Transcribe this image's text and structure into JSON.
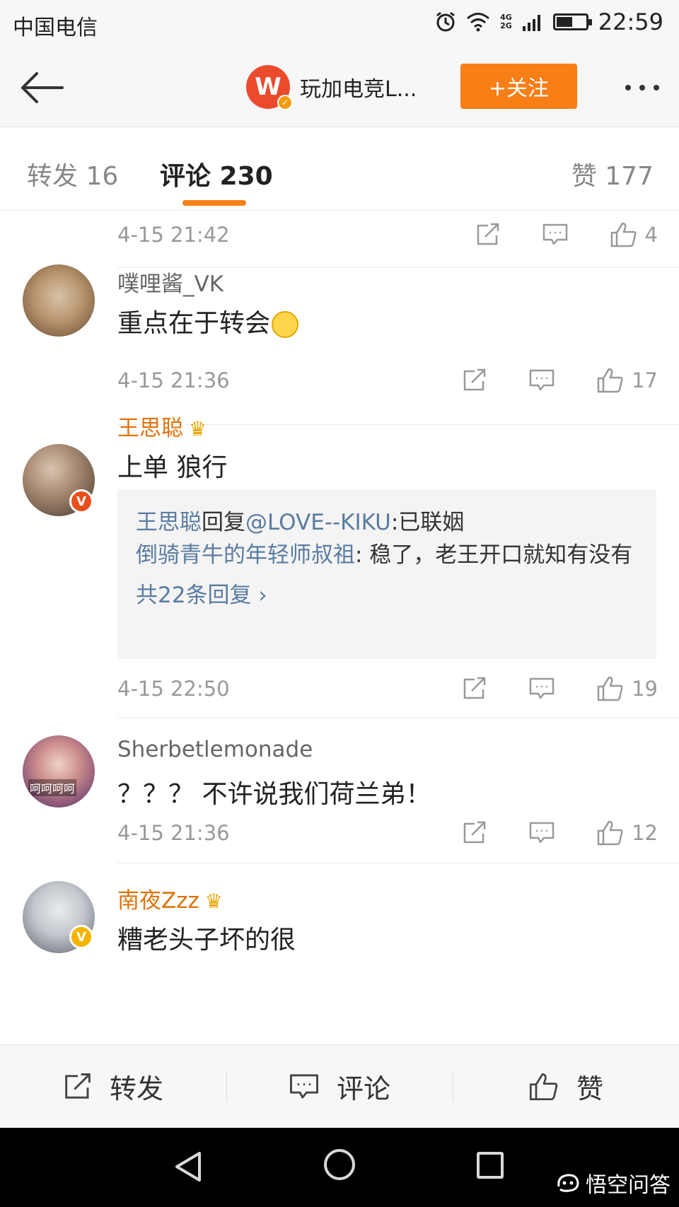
{
  "status_bar": {
    "carrier": "中国电信",
    "network_top": "4G",
    "network_bottom": "2G",
    "time": "22:59"
  },
  "header": {
    "account_logo_letter": "W",
    "account_name": "玩加电竞L...",
    "follow_label": "+关注"
  },
  "tabs": {
    "repost": "转发 16",
    "comment": "评论 230",
    "like": "赞 177"
  },
  "comments": [
    {
      "time": "4-15 21:42",
      "likes": "4"
    },
    {
      "username": "噗哩酱_VK",
      "text": "重点在于转会",
      "time": "4-15 21:36",
      "likes": "17"
    },
    {
      "username": "王思聪",
      "text": "上单 狼行",
      "replies": {
        "line1_name": "王思聪",
        "line1_mid": "回复",
        "line1_mention": "@LOVE--KIKU",
        "line1_text": ":已联姻",
        "line2_name": "倒骑青牛的年轻师叔祖",
        "line2_text": ": 稳了，老王开口就知有没有",
        "more": "共22条回复 ›"
      },
      "time": "4-15 22:50",
      "likes": "19"
    },
    {
      "username": "Sherbetlemonade",
      "avatar_caption": "呵呵呵呵",
      "text": "？？？ 不许说我们荷兰弟！",
      "time": "4-15 21:36",
      "likes": "12"
    },
    {
      "username": "南夜Zzz",
      "text": "糟老头子坏的很"
    }
  ],
  "bottom_bar": {
    "repost": "转发",
    "comment": "评论",
    "like": "赞"
  },
  "watermark": "悟空问答",
  "colors": {
    "accent_orange": "#f87e16",
    "link_blue": "#5a7ca1",
    "vip_gold": "#e0730c"
  },
  "icons": [
    "back-arrow-icon",
    "more-dots-icon",
    "share-icon",
    "comment-icon",
    "thumb-up-icon",
    "crown-icon",
    "verified-icon",
    "alarm-icon",
    "wifi-icon",
    "signal-icon",
    "battery-icon"
  ]
}
